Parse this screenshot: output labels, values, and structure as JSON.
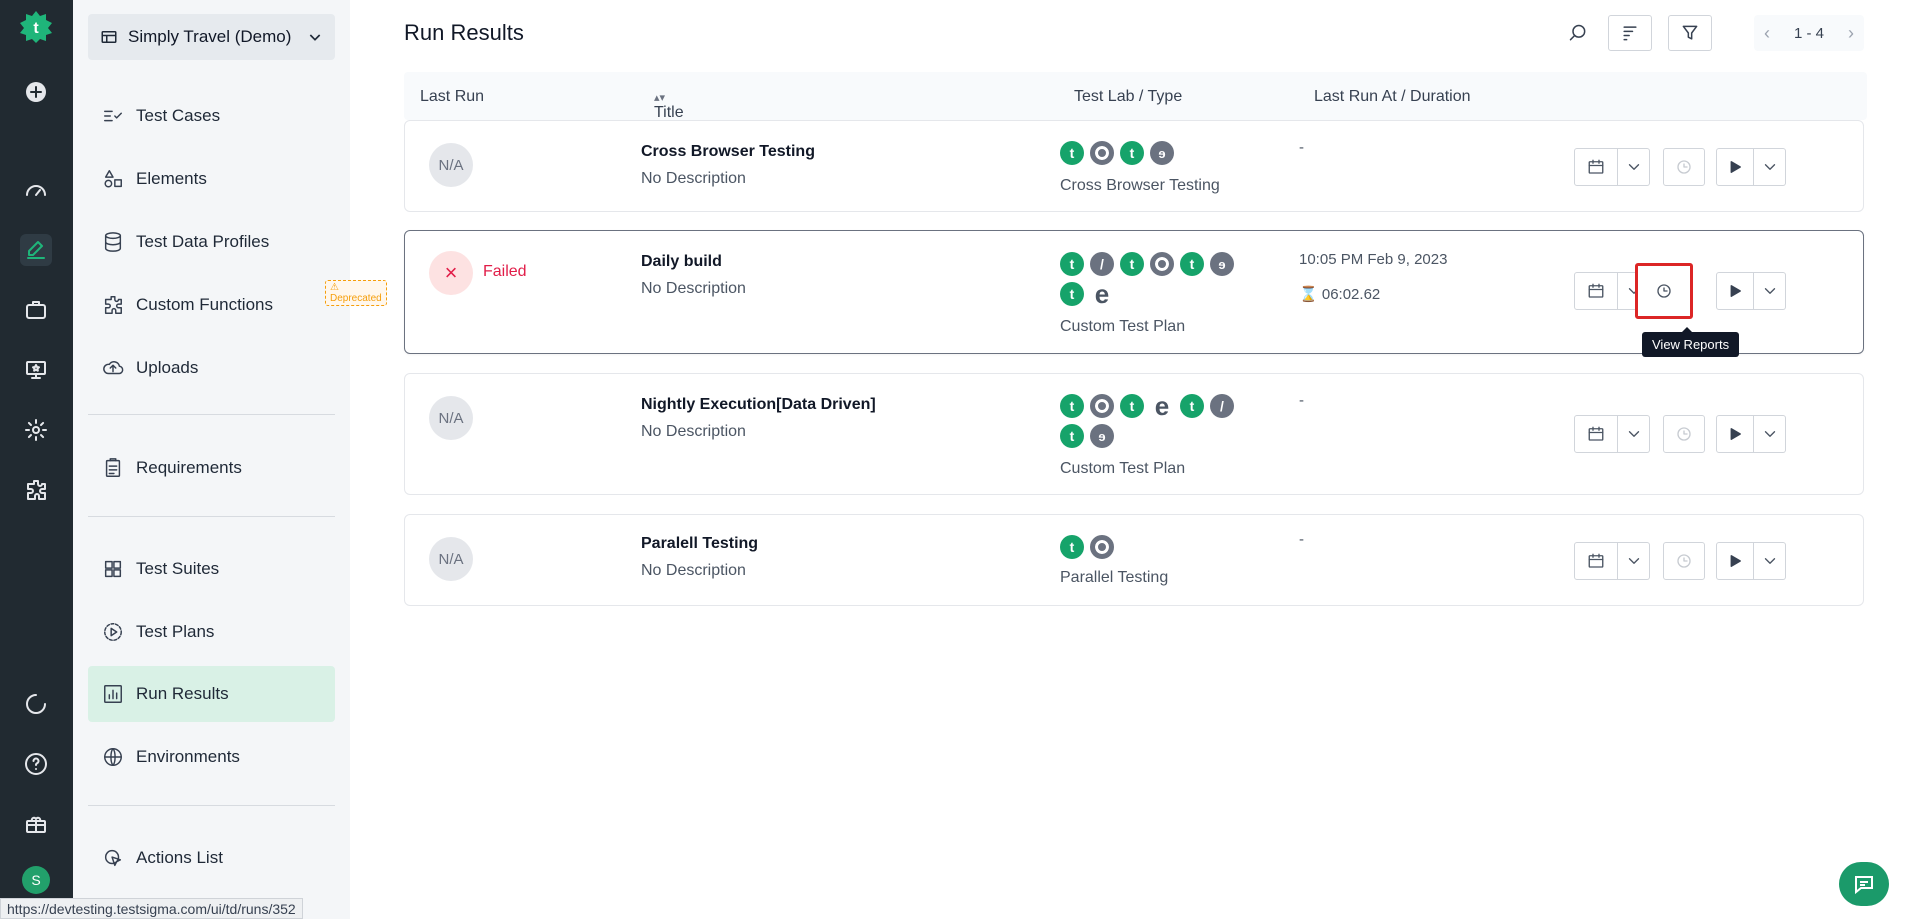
{
  "sidebar": {
    "project": "Simply Travel (Demo)",
    "items": [
      {
        "label": "Test Cases"
      },
      {
        "label": "Elements"
      },
      {
        "label": "Test Data Profiles"
      },
      {
        "label": "Custom Functions",
        "badge": "Deprecated"
      },
      {
        "label": "Uploads"
      },
      {
        "label": "Requirements"
      },
      {
        "label": "Test Suites"
      },
      {
        "label": "Test Plans"
      },
      {
        "label": "Run Results",
        "active": true
      },
      {
        "label": "Environments"
      },
      {
        "label": "Actions List"
      }
    ]
  },
  "user": {
    "initial": "S"
  },
  "header": {
    "title": "Run Results",
    "pagination": "1 - 4"
  },
  "table": {
    "columns": [
      "Last Run",
      "Title",
      "Test Lab / Type",
      "Last Run At / Duration"
    ],
    "rows": [
      {
        "status": "N/A",
        "status_text": "",
        "title": "Cross Browser Testing",
        "description": "No Description",
        "labs": [
          "testsigma",
          "chrome",
          "testsigma",
          "firefox"
        ],
        "type": "Cross Browser Testing",
        "last_run": "-",
        "duration": ""
      },
      {
        "status": "×",
        "status_text": "Failed",
        "title": "Daily build",
        "description": "No Description",
        "labs": [
          "testsigma",
          "safari",
          "testsigma",
          "chrome",
          "testsigma",
          "firefox",
          "testsigma",
          "edge"
        ],
        "type": "Custom Test Plan",
        "last_run": "10:05 PM Feb 9, 2023",
        "duration": "06:02.62"
      },
      {
        "status": "N/A",
        "status_text": "",
        "title": "Nightly Execution[Data Driven]",
        "description": "No Description",
        "labs": [
          "testsigma",
          "chrome",
          "testsigma",
          "edge",
          "testsigma",
          "safari",
          "testsigma",
          "firefox"
        ],
        "type": "Custom Test Plan",
        "last_run": "-",
        "duration": ""
      },
      {
        "status": "N/A",
        "status_text": "",
        "title": "Paralell Testing",
        "description": "No Description",
        "labs": [
          "testsigma",
          "chrome"
        ],
        "type": "Parallel Testing",
        "last_run": "-",
        "duration": ""
      }
    ]
  },
  "tooltip": "View Reports",
  "status_bar_url": "https://devtesting.testsigma.com/ui/td/runs/352",
  "colors": {
    "rail": "#212a31",
    "accent": "#16a36a",
    "failed": "#e11d48",
    "highlight": "#dc2626"
  }
}
